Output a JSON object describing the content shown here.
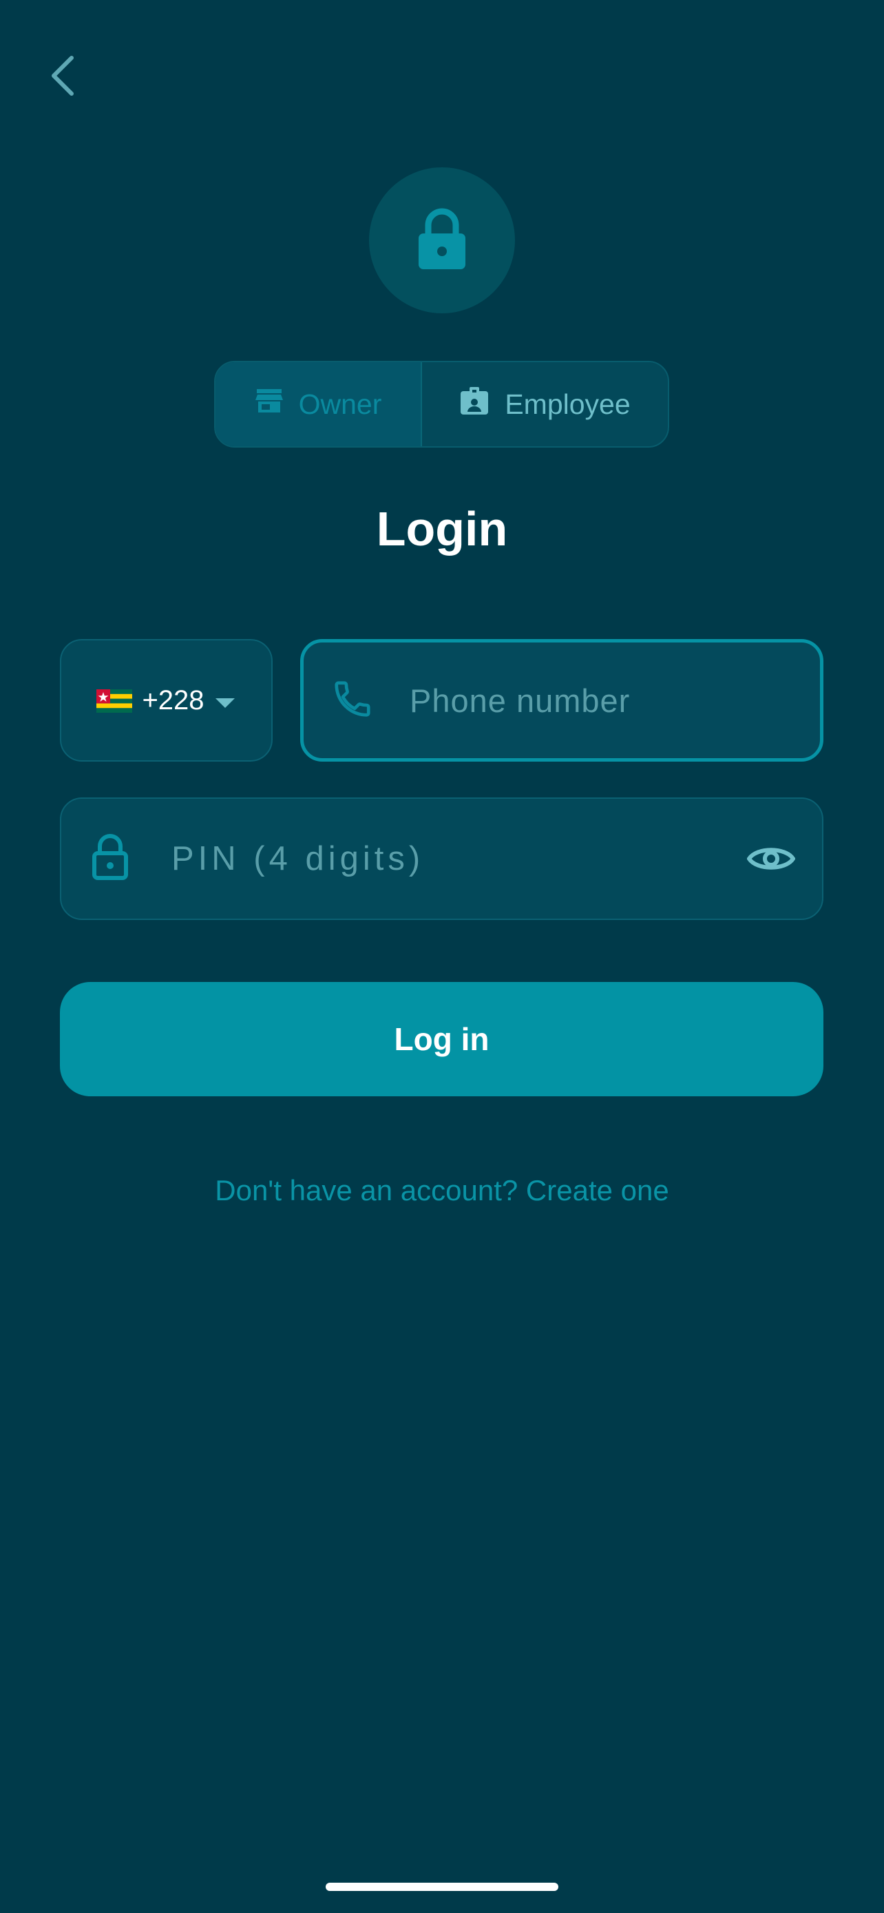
{
  "header": {
    "back_icon": "chevron-left-icon"
  },
  "hero": {
    "icon": "lock-icon"
  },
  "role_toggle": {
    "owner_label": "Owner",
    "owner_icon": "store-icon",
    "employee_label": "Employee",
    "employee_icon": "badge-icon",
    "selected": "Owner"
  },
  "title": "Login",
  "country": {
    "flag": "Togo",
    "code": "+228",
    "icon": "caret-down-icon"
  },
  "phone": {
    "placeholder": "Phone number",
    "value": "",
    "icon": "phone-icon"
  },
  "pin": {
    "placeholder": "PIN (4 digits)",
    "value": "",
    "icon": "lock-icon",
    "toggle_icon": "eye-icon"
  },
  "login_button": {
    "label": "Log in"
  },
  "signup": {
    "text": "Don't have an account? Create one"
  },
  "colors": {
    "background": "#003a4a",
    "accent": "#0393a4",
    "field": "#03495a",
    "placeholder": "#5a9ea9"
  }
}
